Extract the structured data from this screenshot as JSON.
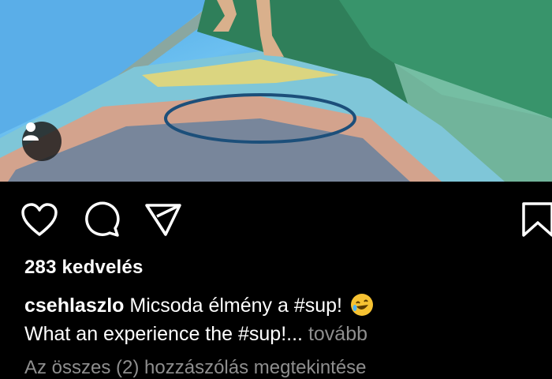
{
  "post": {
    "likes_text": "283 kedvelés",
    "username": "csehlaszlo",
    "caption_line1": "Micsoda élmény a #sup!",
    "caption_line2": "What an experience the #sup!...",
    "more_label": "tovább",
    "view_comments": "Az összes (2) hozzászólás megtekintése"
  },
  "icons": {
    "avatar": "person-icon",
    "like": "heart-icon",
    "comment": "comment-bubble-icon",
    "share": "paper-plane-icon",
    "save": "bookmark-icon",
    "emoji": "rofl-emoji-icon"
  }
}
